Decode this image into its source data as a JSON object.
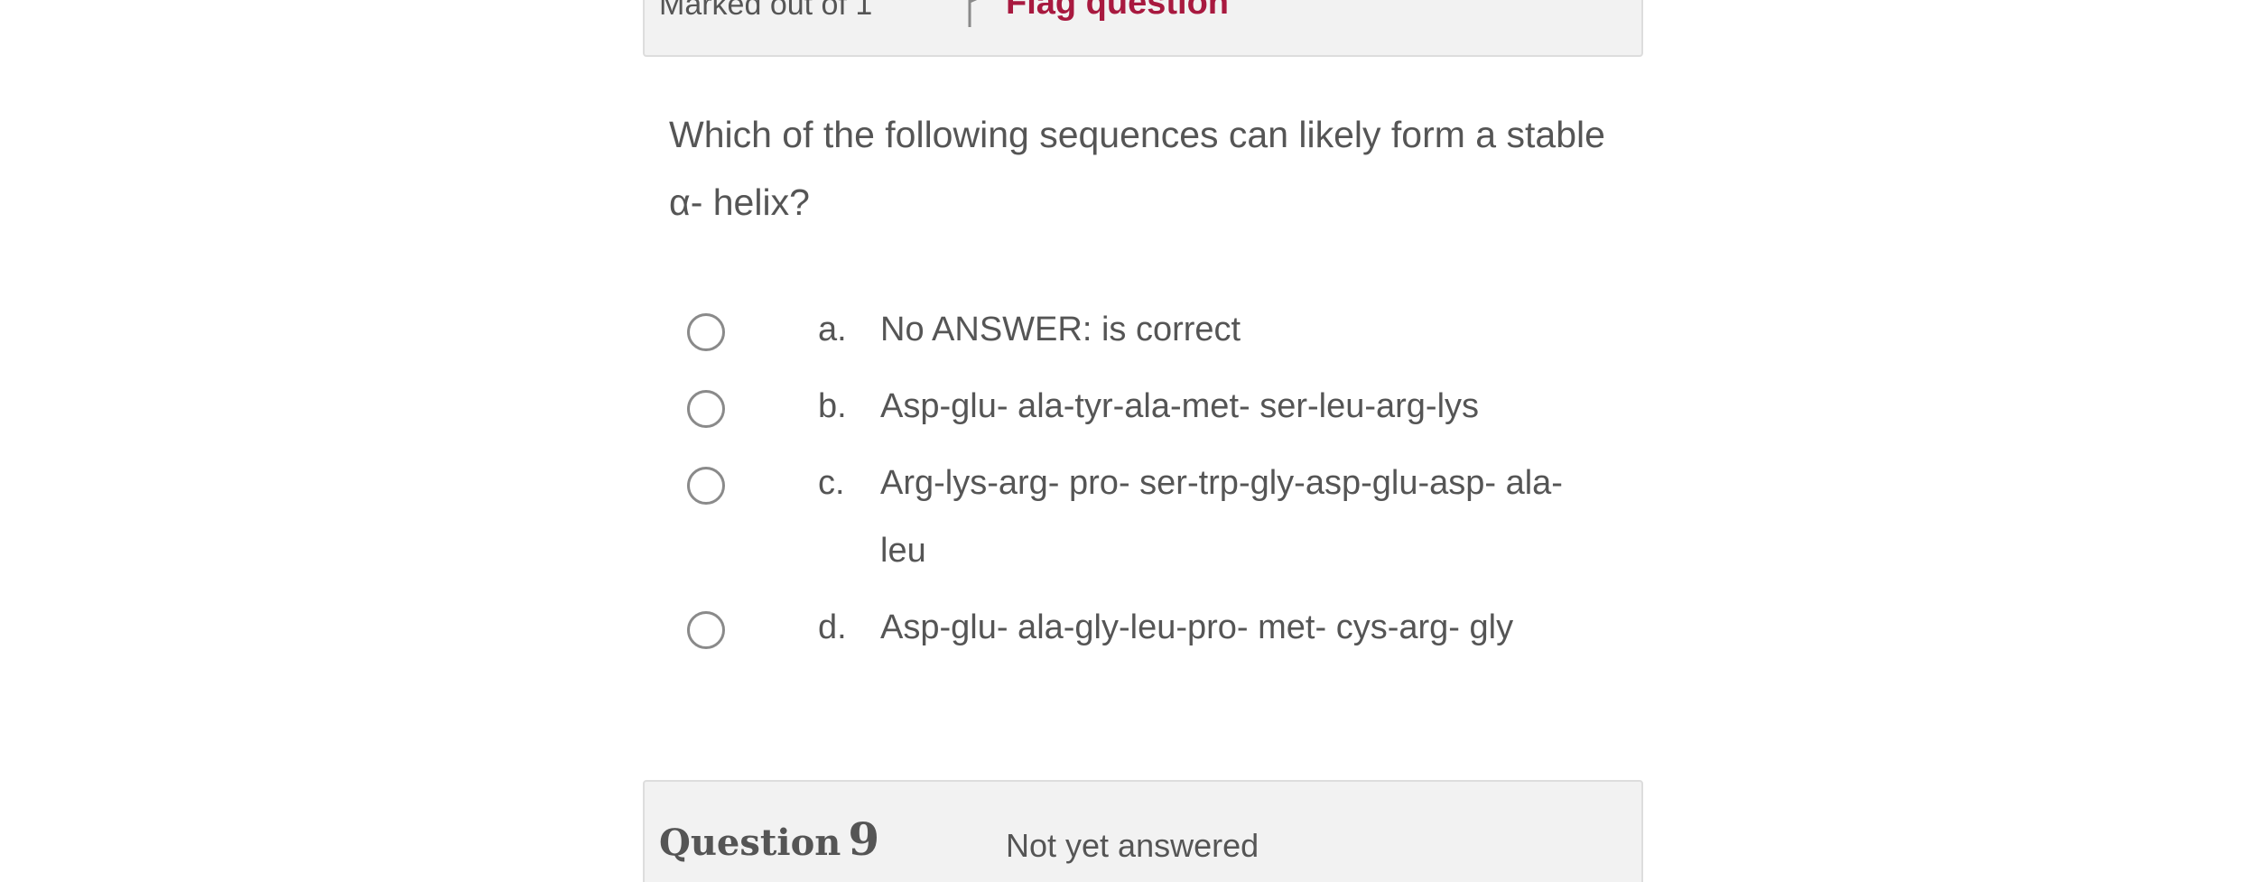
{
  "previous_info": {
    "marked_out": "Marked out of 1",
    "flag_label": "Flag question"
  },
  "question": {
    "text": "Which of the following sequences can likely form a stable α- helix?"
  },
  "answers": [
    {
      "letter": "a.",
      "text": "No ANSWER: is correct"
    },
    {
      "letter": "b.",
      "text": "Asp-glu- ala-tyr-ala-met- ser-leu-arg-lys"
    },
    {
      "letter": "c.",
      "text": "Arg-lys-arg- pro- ser-trp-gly-asp-glu-asp- ala-leu"
    },
    {
      "letter": "d.",
      "text": "Asp-glu- ala-gly-leu-pro- met- cys-arg- gly"
    }
  ],
  "next_question": {
    "label": "Question",
    "number": "9",
    "state": "Not yet answered"
  },
  "colors": {
    "flag": "#a8193f",
    "panel_bg": "#f2f2f2",
    "text": "#555555"
  }
}
